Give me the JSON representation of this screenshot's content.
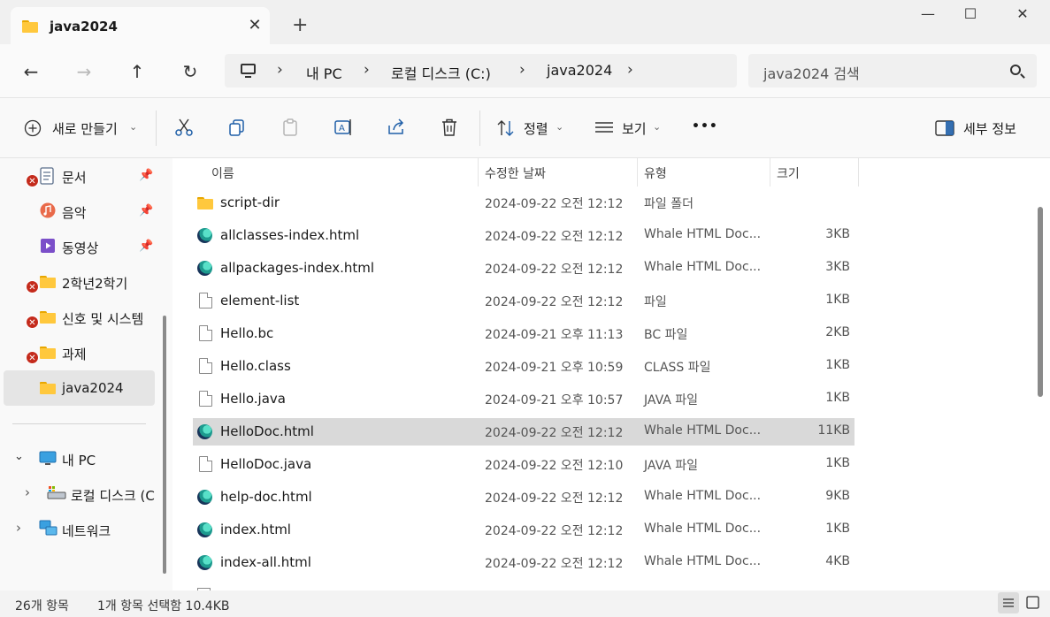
{
  "window": {
    "tab_title": "java2024",
    "tab_close": "✕",
    "new_tab": "+",
    "minimize": "—",
    "maximize": "☐",
    "close": "✕"
  },
  "nav": {
    "back": "←",
    "forward": "→",
    "up": "↑",
    "refresh": "↻"
  },
  "breadcrumb": [
    "내 PC",
    "로컬 디스크 (C:)",
    "java2024"
  ],
  "search": {
    "placeholder": "java2024 검색"
  },
  "toolbar": {
    "new_label": "새로 만들기",
    "sort_label": "정렬",
    "view_label": "보기",
    "more_label": "•••",
    "details_label": "세부 정보"
  },
  "sidebar": {
    "items": [
      {
        "label": "문서",
        "pinned": true,
        "error": true,
        "icon": "document-icon"
      },
      {
        "label": "음악",
        "pinned": true,
        "error": false,
        "icon": "music-icon"
      },
      {
        "label": "동영상",
        "pinned": true,
        "error": false,
        "icon": "video-icon"
      },
      {
        "label": "2학년2학기",
        "pinned": false,
        "error": true,
        "icon": "folder-icon"
      },
      {
        "label": "신호 및 시스템",
        "pinned": false,
        "error": true,
        "icon": "folder-icon"
      },
      {
        "label": "과제",
        "pinned": false,
        "error": true,
        "icon": "folder-icon"
      },
      {
        "label": "java2024",
        "pinned": false,
        "error": false,
        "icon": "folder-icon",
        "selected": true
      }
    ],
    "tree": [
      {
        "label": "내 PC",
        "expanded": true
      },
      {
        "label": "로컬 디스크 (C:)",
        "expanded": false
      },
      {
        "label": "네트워크",
        "expanded": false
      }
    ]
  },
  "columns": {
    "name": "이름",
    "date": "수정한 날짜",
    "type": "유형",
    "size": "크기"
  },
  "files": [
    {
      "name": "script-dir",
      "date": "2024-09-22 오전 12:12",
      "type": "파일 폴더",
      "size": "",
      "icon": "folder-icon"
    },
    {
      "name": "allclasses-index.html",
      "date": "2024-09-22 오전 12:12",
      "type": "Whale HTML Doc...",
      "size": "3KB",
      "icon": "whale-icon"
    },
    {
      "name": "allpackages-index.html",
      "date": "2024-09-22 오전 12:12",
      "type": "Whale HTML Doc...",
      "size": "3KB",
      "icon": "whale-icon"
    },
    {
      "name": "element-list",
      "date": "2024-09-22 오전 12:12",
      "type": "파일",
      "size": "1KB",
      "icon": "file-icon"
    },
    {
      "name": "Hello.bc",
      "date": "2024-09-21 오후 11:13",
      "type": "BC 파일",
      "size": "2KB",
      "icon": "file-icon"
    },
    {
      "name": "Hello.class",
      "date": "2024-09-21 오후 10:59",
      "type": "CLASS 파일",
      "size": "1KB",
      "icon": "file-icon"
    },
    {
      "name": "Hello.java",
      "date": "2024-09-21 오후 10:57",
      "type": "JAVA 파일",
      "size": "1KB",
      "icon": "file-icon"
    },
    {
      "name": "HelloDoc.html",
      "date": "2024-09-22 오전 12:12",
      "type": "Whale HTML Doc...",
      "size": "11KB",
      "icon": "whale-icon",
      "selected": true
    },
    {
      "name": "HelloDoc.java",
      "date": "2024-09-22 오전 12:10",
      "type": "JAVA 파일",
      "size": "1KB",
      "icon": "file-icon"
    },
    {
      "name": "help-doc.html",
      "date": "2024-09-22 오전 12:12",
      "type": "Whale HTML Doc...",
      "size": "9KB",
      "icon": "whale-icon"
    },
    {
      "name": "index.html",
      "date": "2024-09-22 오전 12:12",
      "type": "Whale HTML Doc...",
      "size": "1KB",
      "icon": "whale-icon"
    },
    {
      "name": "index-all.html",
      "date": "2024-09-22 오전 12:12",
      "type": "Whale HTML Doc...",
      "size": "4KB",
      "icon": "whale-icon"
    }
  ],
  "status": {
    "item_count": "26개 항목",
    "selection": "1개 항목 선택함 10.4KB"
  },
  "colors": {
    "selected_row": "#d9d9d9",
    "folder": "#ffc83d",
    "error": "#c42b1c"
  }
}
